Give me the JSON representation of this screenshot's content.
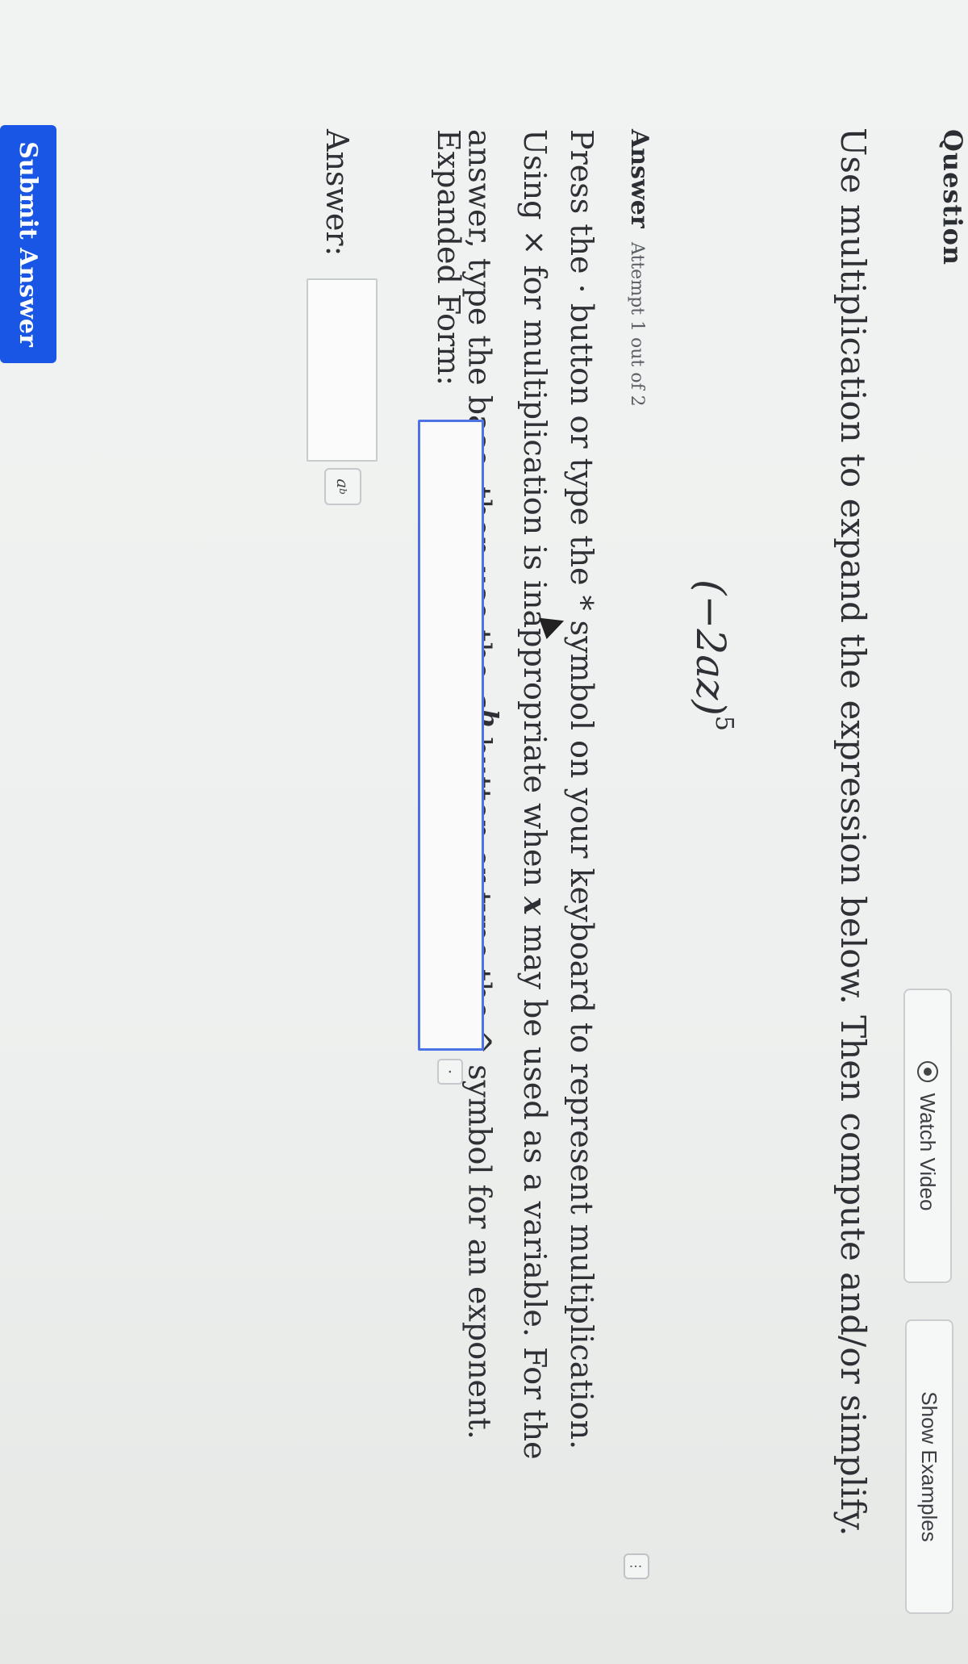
{
  "question": {
    "heading": "Question",
    "watch_video_label": "Watch Video",
    "show_examples_label": "Show Examples",
    "instruction": "Use multiplication to expand the expression below. Then compute and/or simplify.",
    "expression_base": "(−2az)",
    "expression_exponent": "5"
  },
  "answer": {
    "heading": "Answer",
    "attempt": "Attempt 1 out of 2",
    "help_line1_a": "Press the · button or type the * symbol on your keyboard to represent multiplication.",
    "help_line2_a": "Using × for multiplication is inappropriate when ",
    "help_line2_var": "x",
    "help_line2_b": " may be used as a variable. For the",
    "help_line3_a": "answer, type the base, then use the ",
    "help_line3_base": "a",
    "help_line3_exp": "b",
    "help_line3_b": " button or type the ^ symbol for an exponent.",
    "expanded_label": "Expanded Form:",
    "expanded_value": "",
    "dot_button_label": "·",
    "answer_label": "Answer:",
    "answer_value": "",
    "pow_base": "a",
    "pow_exp": "b",
    "submit_label": "Submit Answer",
    "corner_icon": "⋮"
  },
  "icons": {
    "watch": "play-circle-icon",
    "cursor": "mouse-pointer-icon"
  }
}
